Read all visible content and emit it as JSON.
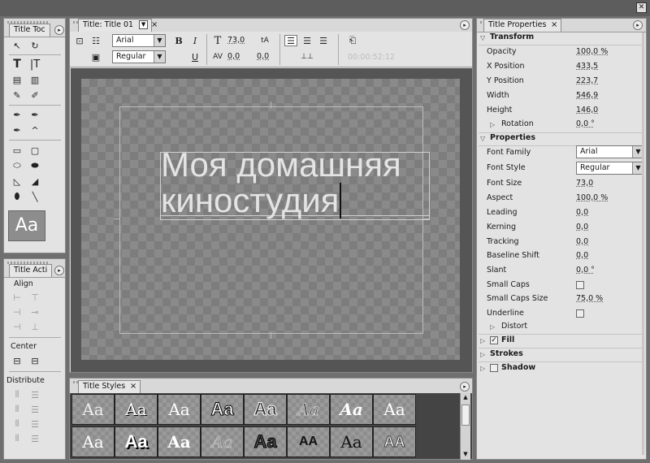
{
  "window": {
    "close_label": "✕"
  },
  "tools_panel": {
    "tab_label": "Title Toc",
    "tools": [
      "selection-tool",
      "rotation-tool",
      "type-tool",
      "vertical-type-tool",
      "area-type-tool",
      "vertical-area-type-tool",
      "path-type-tool",
      "vertical-path-type-tool",
      "pen-tool",
      "add-anchor-tool",
      "delete-anchor-tool",
      "convert-anchor-tool",
      "rectangle-tool",
      "rounded-rectangle-tool",
      "clipped-corner-tool",
      "rounded-corner-tool",
      "wedge-tool",
      "arc-tool",
      "ellipse-tool",
      "line-tool"
    ],
    "preview_text": "Aa"
  },
  "actions_panel": {
    "tab_label": "Title Acti",
    "align_label": "Align",
    "center_label": "Center",
    "distribute_label": "Distribute"
  },
  "title_panel": {
    "tab_label": "Title: Title 01",
    "font_family": "Arial",
    "font_style": "Regular",
    "bold_label": "B",
    "italic_label": "I",
    "underline_label": "U",
    "size_value": "73,0",
    "kerning_value": "0,0",
    "leading_value": "0,0",
    "timecode": "00:00:52:12",
    "canvas_text_line1": "Моя домашняя",
    "canvas_text_line2": "киностудия"
  },
  "styles_panel": {
    "tab_label": "Title Styles",
    "samples": [
      "Aa",
      "Aa",
      "Aa",
      "Aa",
      "Aa",
      "Aa",
      "Aa",
      "Aa",
      "Aa",
      "Aa",
      "Aa",
      "Aa",
      "Aa",
      "AA",
      "Aa",
      "AA"
    ]
  },
  "properties_panel": {
    "tab_label": "Title Properties",
    "transform": {
      "header": "Transform",
      "opacity_label": "Opacity",
      "opacity_value": "100,0 %",
      "xpos_label": "X Position",
      "xpos_value": "433,5",
      "ypos_label": "Y Position",
      "ypos_value": "223,7",
      "width_label": "Width",
      "width_value": "546,9",
      "height_label": "Height",
      "height_value": "146,0",
      "rotation_label": "Rotation",
      "rotation_value": "0,0 °"
    },
    "properties": {
      "header": "Properties",
      "font_family_label": "Font Family",
      "font_family_value": "Arial",
      "font_style_label": "Font Style",
      "font_style_value": "Regular",
      "font_size_label": "Font Size",
      "font_size_value": "73,0",
      "aspect_label": "Aspect",
      "aspect_value": "100,0 %",
      "leading_label": "Leading",
      "leading_value": "0,0",
      "kerning_label": "Kerning",
      "kerning_value": "0,0",
      "tracking_label": "Tracking",
      "tracking_value": "0,0",
      "baseline_label": "Baseline Shift",
      "baseline_value": "0,0",
      "slant_label": "Slant",
      "slant_value": "0,0 °",
      "small_caps_label": "Small Caps",
      "small_caps_size_label": "Small Caps Size",
      "small_caps_size_value": "75,0 %",
      "underline_label": "Underline",
      "distort_label": "Distort"
    },
    "fill_label": "Fill",
    "strokes_label": "Strokes",
    "shadow_label": "Shadow"
  }
}
